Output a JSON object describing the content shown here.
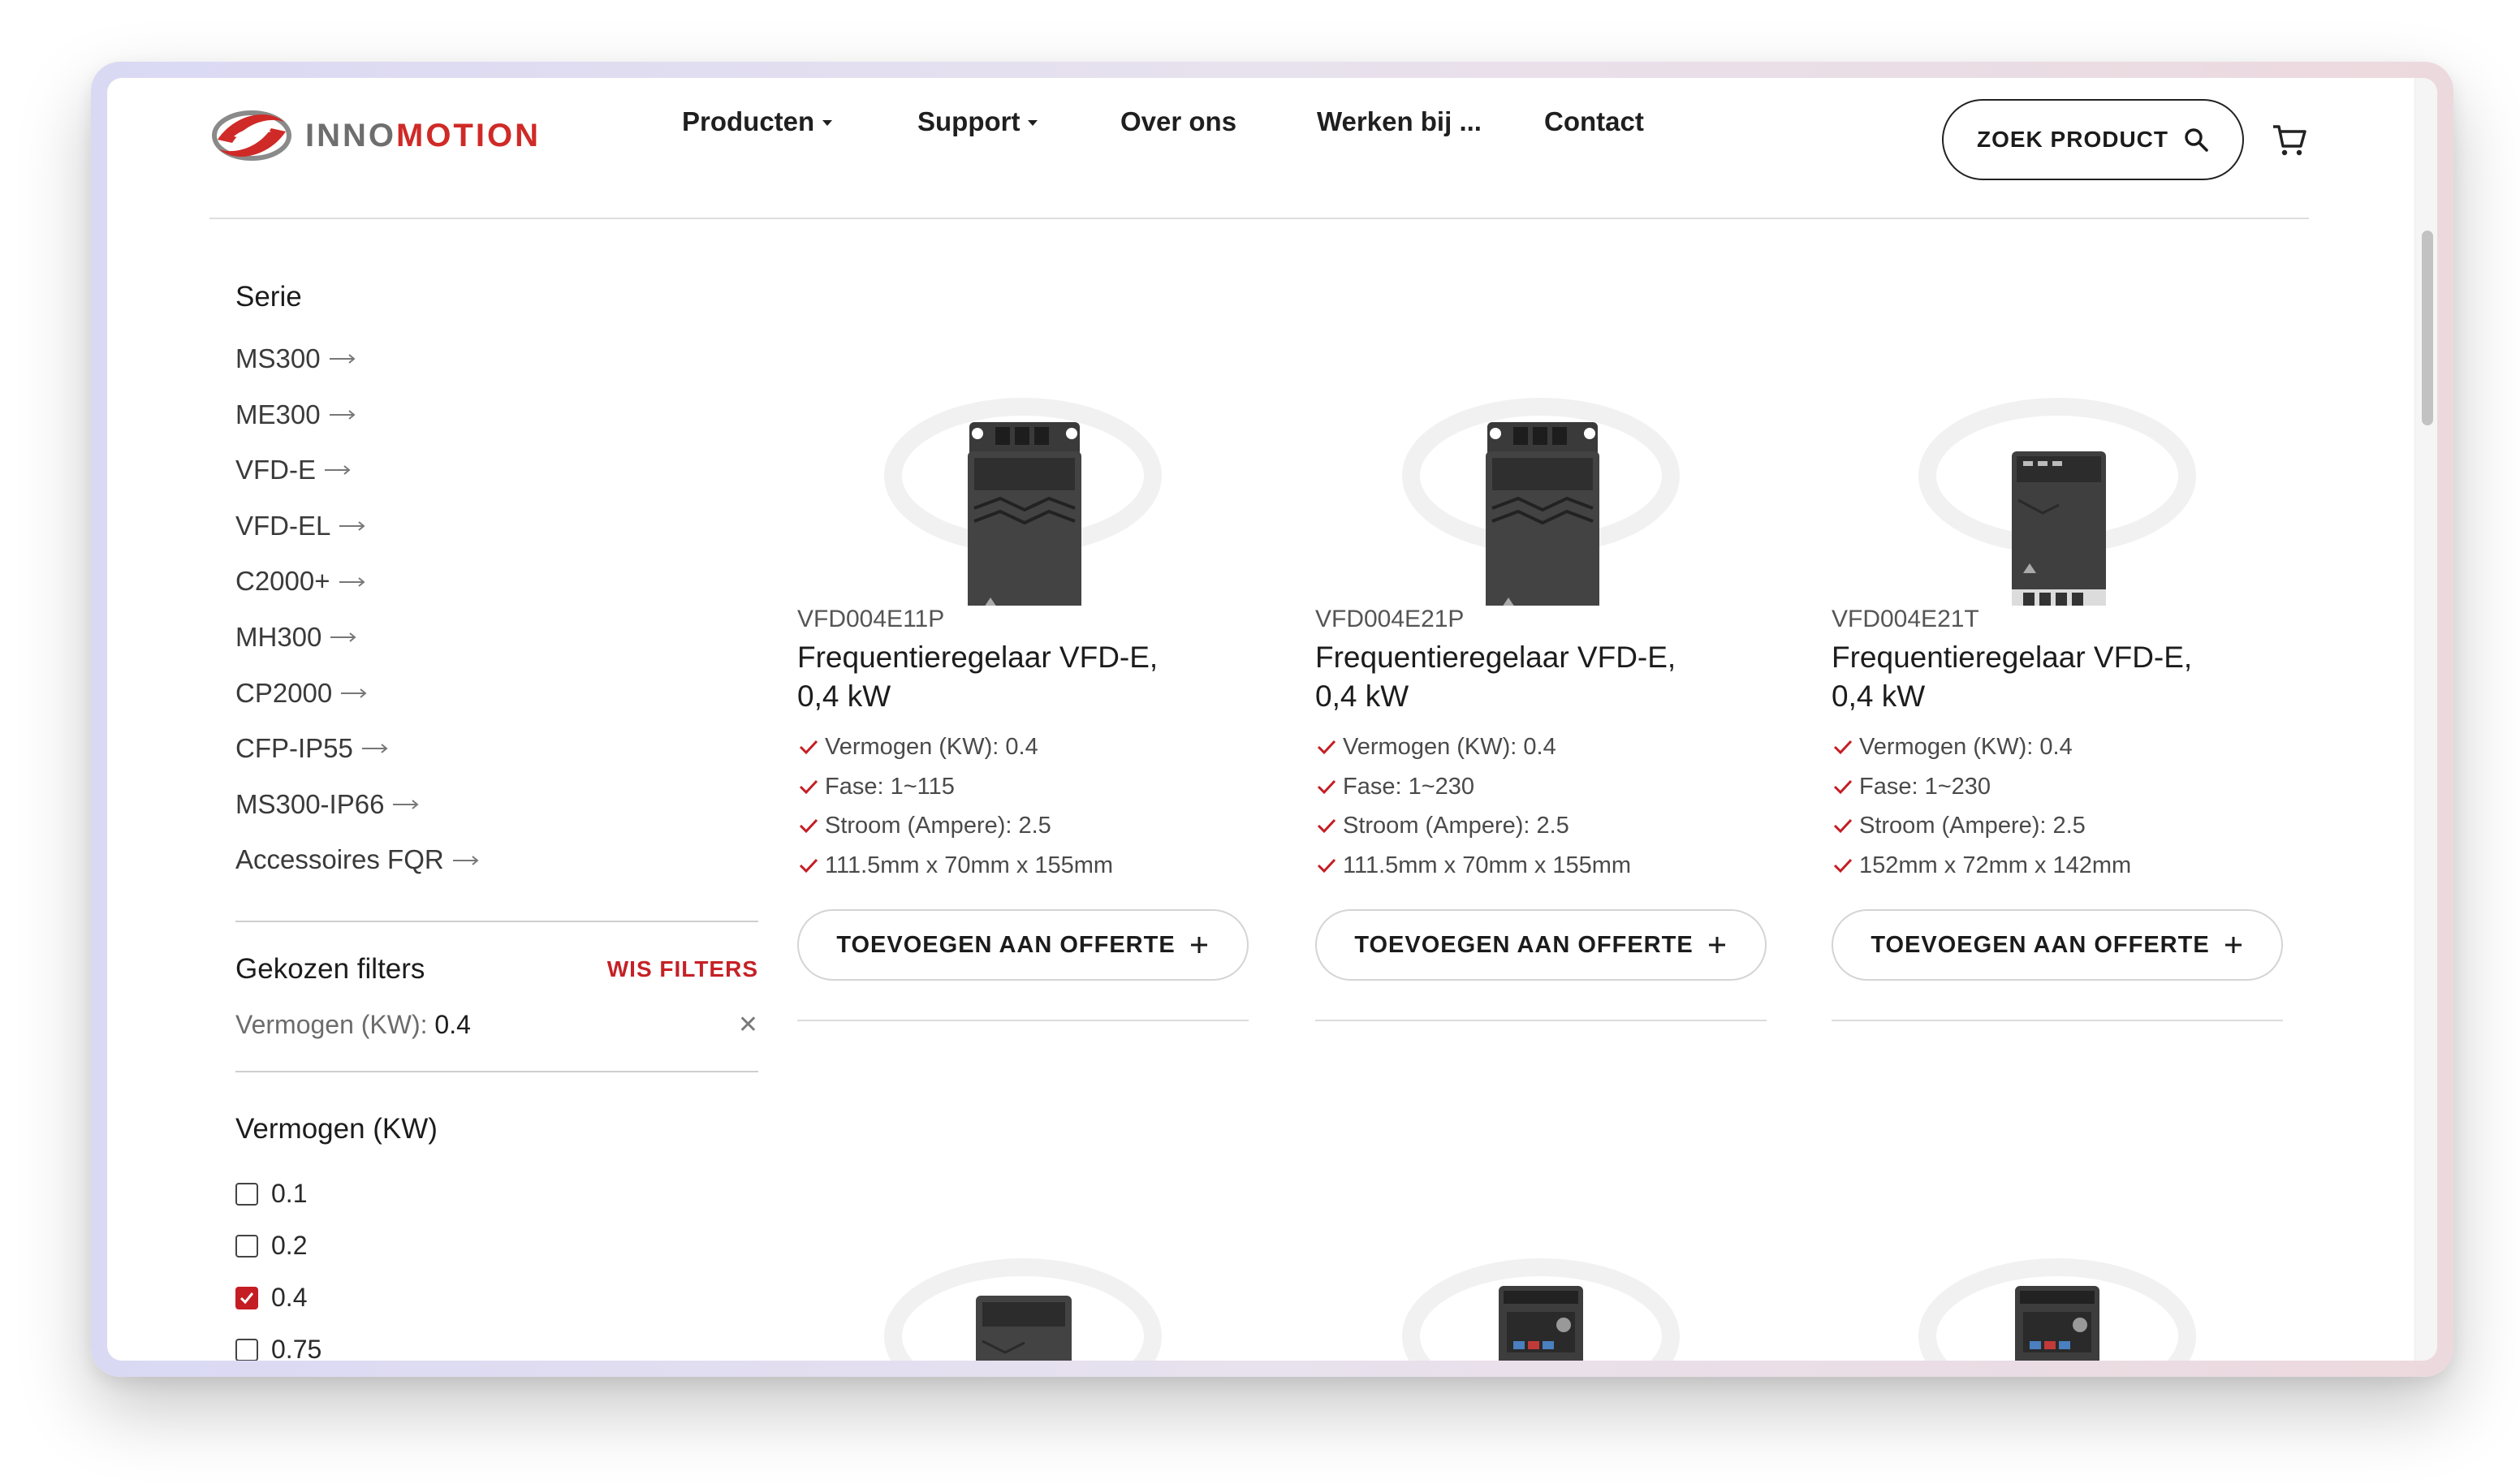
{
  "brand": {
    "part1": "INNO",
    "part2": "MOTION"
  },
  "nav": {
    "items": [
      {
        "label": "Producten",
        "dropdown": true
      },
      {
        "label": "Support",
        "dropdown": true
      },
      {
        "label": "Over ons",
        "dropdown": false
      },
      {
        "label": "Werken bij ...",
        "dropdown": false
      },
      {
        "label": "Contact",
        "dropdown": false
      }
    ],
    "search_label": "ZOEK PRODUCT"
  },
  "sidebar": {
    "series_title": "Serie",
    "series": [
      "MS300",
      "ME300",
      "VFD-E",
      "VFD-EL",
      "C2000+",
      "MH300",
      "CP2000",
      "CFP-IP55",
      "MS300-IP66",
      "Accessoires FQR"
    ],
    "chosen_title": "Gekozen filters",
    "clear_label": "WIS FILTERS",
    "chosen": {
      "label": "Vermogen (KW):",
      "value": "0.4"
    },
    "power_title": "Vermogen (KW)",
    "power_options": [
      {
        "label": "0.1",
        "checked": false
      },
      {
        "label": "0.2",
        "checked": false
      },
      {
        "label": "0.4",
        "checked": true
      },
      {
        "label": "0.75",
        "checked": false
      }
    ]
  },
  "products": [
    {
      "sku": "VFD004E11P",
      "name_line1": "Frequentieregelaar VFD-E,",
      "name_line2": "0,4 kW",
      "specs": [
        "Vermogen (KW): 0.4",
        "Fase: 1~115",
        "Stroom (Ampere): 2.5",
        "111.5mm x 70mm x 155mm"
      ],
      "button": "TOEVOEGEN AAN OFFERTE"
    },
    {
      "sku": "VFD004E21P",
      "name_line1": "Frequentieregelaar VFD-E,",
      "name_line2": "0,4 kW",
      "specs": [
        "Vermogen (KW): 0.4",
        "Fase: 1~230",
        "Stroom (Ampere): 2.5",
        "111.5mm x 70mm x 155mm"
      ],
      "button": "TOEVOEGEN AAN OFFERTE"
    },
    {
      "sku": "VFD004E21T",
      "name_line1": "Frequentieregelaar VFD-E,",
      "name_line2": "0,4 kW",
      "specs": [
        "Vermogen (KW): 0.4",
        "Fase: 1~230",
        "Stroom (Ampere): 2.5",
        "152mm x 72mm x 142mm"
      ],
      "button": "TOEVOEGEN AAN OFFERTE"
    }
  ],
  "colors": {
    "accent": "#cf2a27",
    "check": "#c41d23"
  }
}
